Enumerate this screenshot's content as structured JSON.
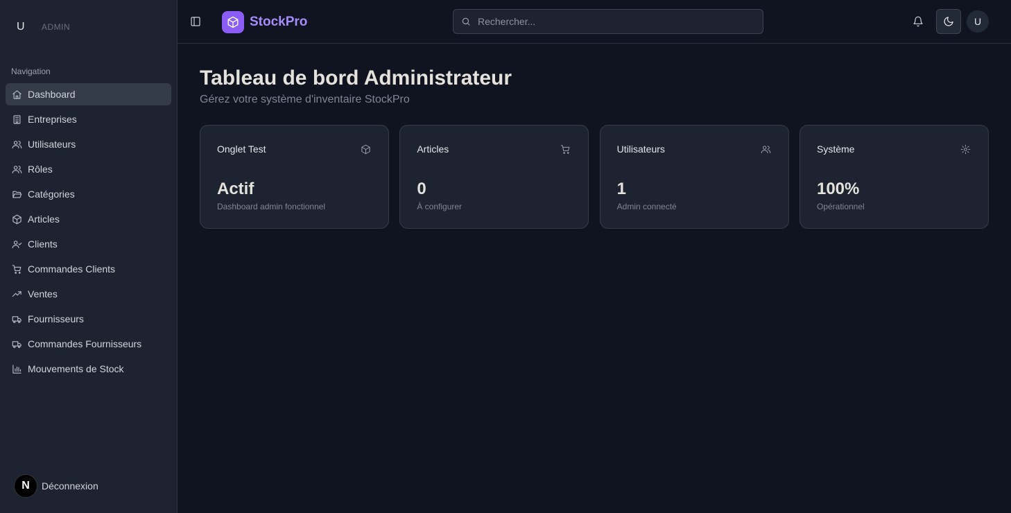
{
  "sidebar": {
    "user_initial": "U",
    "user_role": "ADMIN",
    "section_label": "Navigation",
    "items": [
      {
        "label": "Dashboard",
        "icon": "home-icon",
        "active": true
      },
      {
        "label": "Entreprises",
        "icon": "building-icon"
      },
      {
        "label": "Utilisateurs",
        "icon": "users-icon"
      },
      {
        "label": "Rôles",
        "icon": "users-icon"
      },
      {
        "label": "Catégories",
        "icon": "folder-open-icon"
      },
      {
        "label": "Articles",
        "icon": "package-icon"
      },
      {
        "label": "Clients",
        "icon": "user-check-icon"
      },
      {
        "label": "Commandes Clients",
        "icon": "shopping-cart-icon"
      },
      {
        "label": "Ventes",
        "icon": "trending-up-icon"
      },
      {
        "label": "Fournisseurs",
        "icon": "truck-icon"
      },
      {
        "label": "Commandes Fournisseurs",
        "icon": "truck-icon"
      },
      {
        "label": "Mouvements de Stock",
        "icon": "bar-chart-icon"
      }
    ],
    "logout_badge": "N",
    "logout_label": "Déconnexion"
  },
  "header": {
    "brand": "StockPro",
    "search_placeholder": "Rechercher...",
    "avatar_initial": "U"
  },
  "main": {
    "title": "Tableau de bord Administrateur",
    "subtitle": "Gérez votre système d'inventaire StockPro",
    "cards": [
      {
        "title": "Onglet Test",
        "value": "Actif",
        "desc": "Dashboard admin fonctionnel",
        "icon": "package-icon"
      },
      {
        "title": "Articles",
        "value": "0",
        "desc": "À configurer",
        "icon": "shopping-cart-icon"
      },
      {
        "title": "Utilisateurs",
        "value": "1",
        "desc": "Admin connecté",
        "icon": "users-icon"
      },
      {
        "title": "Système",
        "value": "100%",
        "desc": "Opérationnel",
        "icon": "gear-icon"
      }
    ]
  },
  "colors": {
    "background": "#0f1420",
    "sidebar": "#1d2330",
    "accent": "#8b5cf6",
    "brand_text": "#a78bfa"
  }
}
